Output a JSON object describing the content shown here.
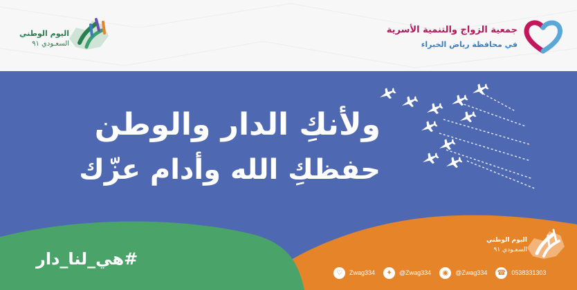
{
  "header": {
    "left_logo": {
      "line1": "اليوم الوطني",
      "line2": "السعـودي ٩١"
    },
    "right_logo": {
      "line1": "جمعية الزواج والتنمية الأسرية",
      "line2": "في محافظة رياض الخبراء"
    }
  },
  "banner": {
    "line1": "ولأنكِ الدار والوطن",
    "line2": "حفظكِ الله وأدام عزّك",
    "hashtag": "#هي_لنا_دار"
  },
  "footer_logo": {
    "line1": "اليوم الوطني",
    "line2": "السعـودي ٩١"
  },
  "contacts": [
    {
      "icon": "snapchat-icon",
      "text": "Zwag334"
    },
    {
      "icon": "twitter-icon",
      "text": "@Zwag334"
    },
    {
      "icon": "instagram-icon",
      "text": "@Zwag334"
    },
    {
      "icon": "phone-icon",
      "text": "0538331303"
    }
  ],
  "colors": {
    "blue": "#4e69b2",
    "orange": "#e6842a",
    "green": "#4aa46a",
    "magenta": "#b01a5a"
  }
}
